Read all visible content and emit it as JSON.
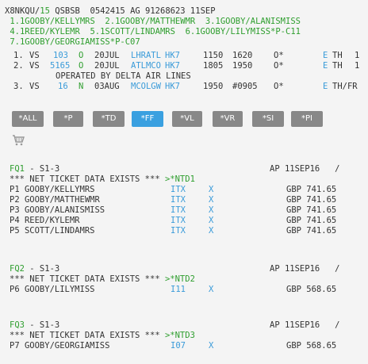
{
  "header": {
    "line1_a": "X8NKQU/",
    "line1_b": "15",
    "line1_c": " QSBSB  0542415 AG 91268623 11SEP"
  },
  "names": {
    "row1": " 1.1GOOBY/KELLYMRS  2.1GOOBY/MATTHEWMR  3.1GOOBY/ALANISMISS",
    "row2": " 4.1REED/KYLEMR  5.1SCOTT/LINDAMRS  6.1GOOBY/LILYMISS*P-C11",
    "row3": " 7.1GOOBY/GEORGIAMISS*P-C07"
  },
  "segments": [
    {
      "num": "1.",
      "carrier": "VS",
      "flight": "103",
      "cls": "O",
      "date": "20JUL",
      "route": "LHRATL",
      "status": "HK7",
      "dep": "1150",
      "arr": "1620",
      "flag": "O*",
      "e": "E",
      "day": "TH",
      "n": "1"
    },
    {
      "num": "2.",
      "carrier": "VS",
      "flight": "5165",
      "cls": "O",
      "date": "20JUL",
      "route": "ATLMCO",
      "status": "HK7",
      "dep": "1805",
      "arr": "1950",
      "flag": "O*",
      "e": "E",
      "day": "TH",
      "n": "1"
    },
    {
      "num": "3.",
      "carrier": "VS",
      "flight": "16",
      "cls": "N",
      "date": "03AUG",
      "route": "MCOLGW",
      "status": "HK7",
      "dep": "1950",
      "arr": "#0905",
      "flag": "O*",
      "e": "E",
      "day": "TH/FR",
      "n": ""
    }
  ],
  "operated_by": "OPERATED BY DELTA AIR LINES",
  "buttons": [
    "*ALL",
    "*P",
    "*TD",
    "*FF",
    "*VL",
    "*VR",
    "*SI",
    "*PI"
  ],
  "active_button": "*FF",
  "cart_icon": "shopping-cart-icon",
  "fare_quotes": [
    {
      "fq": "FQ1",
      "range": " - S1-3",
      "ap": "AP 11SEP16   /",
      "net": "*** NET TICKET DATA EXISTS *** ",
      "ntd": ">*NTD1",
      "pax": [
        {
          "p": "P1 GOOBY/KELLYMRS",
          "code": "ITX",
          "x": "X",
          "amt": "GBP 741.65"
        },
        {
          "p": "P2 GOOBY/MATTHEWMR",
          "code": "ITX",
          "x": "X",
          "amt": "GBP 741.65"
        },
        {
          "p": "P3 GOOBY/ALANISMISS",
          "code": "ITX",
          "x": "X",
          "amt": "GBP 741.65"
        },
        {
          "p": "P4 REED/KYLEMR",
          "code": "ITX",
          "x": "X",
          "amt": "GBP 741.65"
        },
        {
          "p": "P5 SCOTT/LINDAMRS",
          "code": "ITX",
          "x": "X",
          "amt": "GBP 741.65"
        }
      ]
    },
    {
      "fq": "FQ2",
      "range": " - S1-3",
      "ap": "AP 11SEP16   /",
      "net": "*** NET TICKET DATA EXISTS *** ",
      "ntd": ">*NTD2",
      "pax": [
        {
          "p": "P6 GOOBY/LILYMISS",
          "code": "I11",
          "x": "X",
          "amt": "GBP 568.65"
        }
      ]
    },
    {
      "fq": "FQ3",
      "range": " - S1-3",
      "ap": "AP 11SEP16   /",
      "net": "*** NET TICKET DATA EXISTS *** ",
      "ntd": ">*NTD3",
      "pax": [
        {
          "p": "P7 GOOBY/GEORGIAMISS",
          "code": "I07",
          "x": "X",
          "amt": "GBP 568.65"
        }
      ]
    }
  ]
}
